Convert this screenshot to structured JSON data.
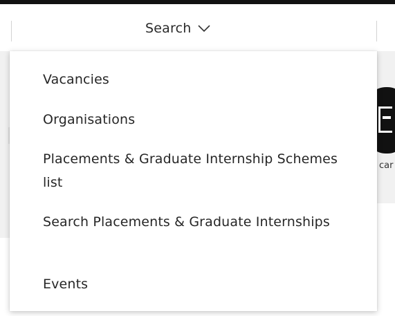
{
  "nav": {
    "search_label": "Search",
    "chevron_icon": "chevron-down-icon"
  },
  "dropdown": {
    "items": [
      {
        "label": "Vacancies"
      },
      {
        "label": "Organisations"
      },
      {
        "label": "Placements & Graduate Internship Schemes list"
      },
      {
        "label": "Search Placements & Graduate Internships"
      },
      {
        "label": "Events"
      }
    ]
  },
  "background": {
    "cut_text": "car"
  },
  "colors": {
    "top_rule": "#111111",
    "text": "#262626",
    "panel": "#f1f1f1",
    "logo": "#111111"
  }
}
